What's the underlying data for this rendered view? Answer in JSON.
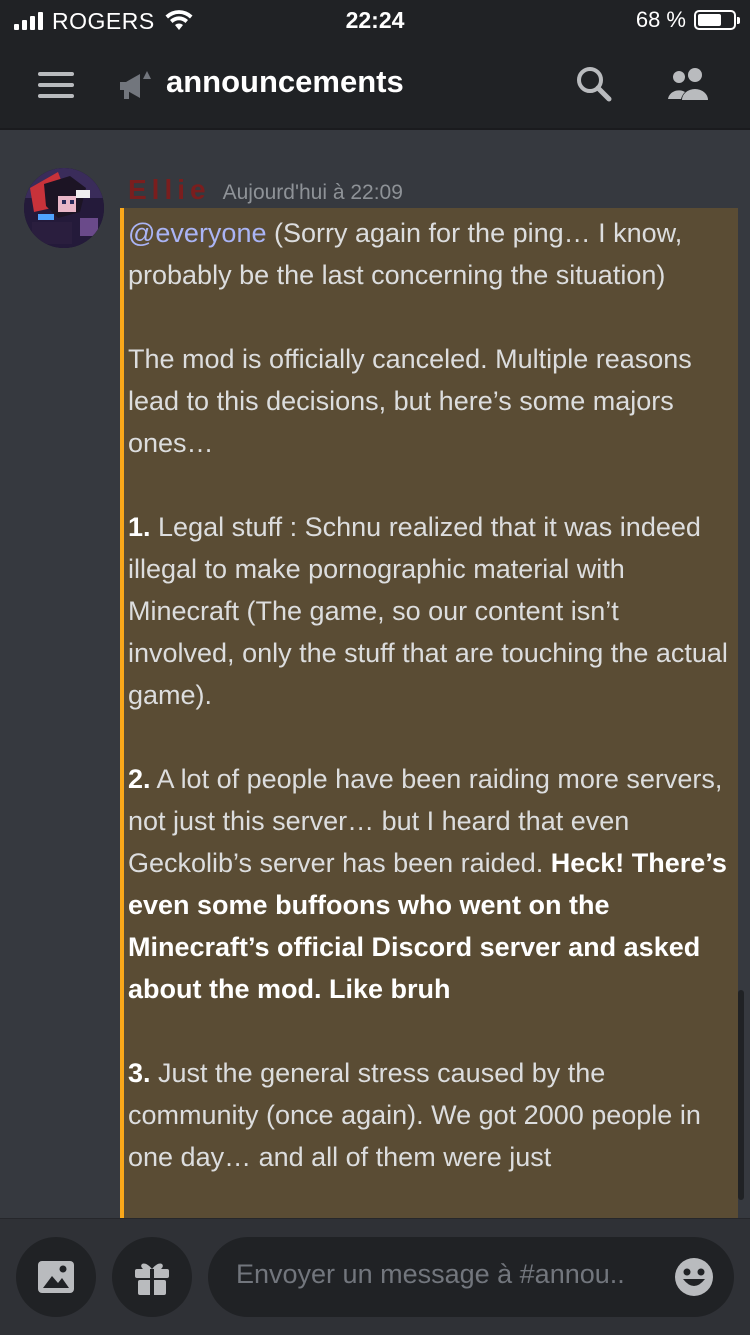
{
  "status_bar": {
    "carrier": "ROGERS",
    "time": "22:24",
    "battery": "68 %",
    "battery_level": 0.68
  },
  "header": {
    "channel_name": "announcements"
  },
  "message": {
    "author": "Ellie",
    "timestamp": "Aujourd'hui à 22:09",
    "mention": "@everyone",
    "p1_rest": " (Sorry again for the ping… I know, probably be the last concerning the situation)",
    "p2": "The mod is officially canceled. Multiple reasons lead to this decisions, but here’s some majors ones…",
    "p3_num": "1.",
    "p3_text": " Legal stuff : Schnu realized that it was indeed illegal to make pornographic material with Minecraft (The game, so our content isn’t involved, only the stuff that are touching the actual game).",
    "p4_num": "2.",
    "p4_text": " A lot of people have been raiding more servers, not just this server… but I heard that even Geckolib’s server has been raided.",
    "p4_bold": "Heck! There’s even some buffoons who went on the Minecraft’s official Discord server and asked about the mod. Like bruh",
    "p5_num": "3.",
    "p5_text": " Just the general stress caused by the community (once again). We got 2000 people in one day… and all of them were just"
  },
  "composer": {
    "placeholder": "Envoyer un message à #annou..",
    "icons": [
      "image-icon",
      "gift-icon",
      "emoji-icon"
    ]
  },
  "colors": {
    "background": "#36393f",
    "header": "#202225",
    "mention_highlight": "#5a4c34",
    "mention_bar": "#faa81a",
    "mention_text": "#aab4f5",
    "author": "#7a1e1e"
  }
}
